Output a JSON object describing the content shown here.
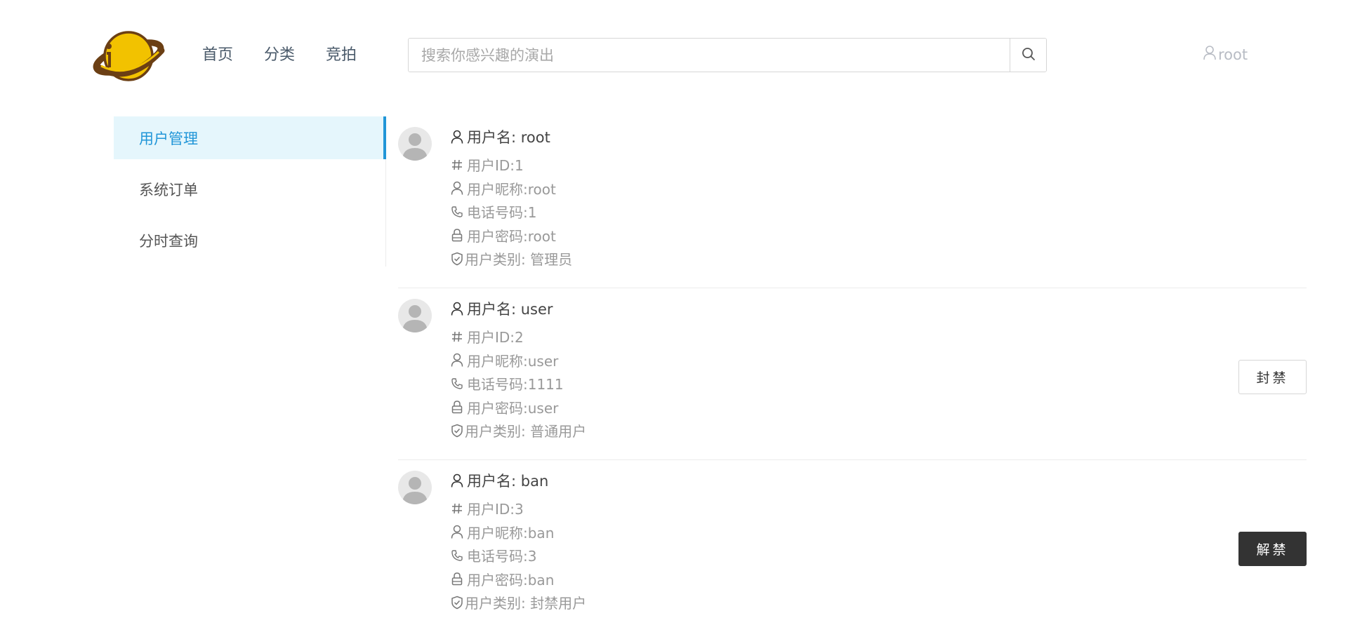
{
  "header": {
    "nav": [
      "首页",
      "分类",
      "竞拍"
    ],
    "search_placeholder": "搜索你感兴趣的演出",
    "current_user": "root"
  },
  "sidebar": {
    "items": [
      {
        "label": "用户管理",
        "active": true
      },
      {
        "label": "系统订单",
        "active": false
      },
      {
        "label": "分时查询",
        "active": false
      }
    ]
  },
  "users": [
    {
      "username": "用户名: root",
      "id": "用户ID:1",
      "nickname": "用户昵称:root",
      "phone": "电话号码:1",
      "password": "用户密码:root",
      "type": "用户类别: 管理员",
      "action": ""
    },
    {
      "username": "用户名: user",
      "id": "用户ID:2",
      "nickname": "用户昵称:user",
      "phone": "电话号码:1111",
      "password": "用户密码:user",
      "type": "用户类别: 普通用户",
      "action": "封禁"
    },
    {
      "username": "用户名: ban",
      "id": "用户ID:3",
      "nickname": "用户昵称:ban",
      "phone": "电话号码:3",
      "password": "用户密码:ban",
      "type": "用户类别: 封禁用户",
      "action": "解禁"
    }
  ],
  "icons": {
    "logo": "planet-logo",
    "search": "search-icon",
    "user": "user-icon",
    "id": "hash-icon",
    "phone": "phone-icon",
    "lock": "lock-icon",
    "shield": "shield-check-icon"
  },
  "colors": {
    "accent": "#2196d8",
    "active_bg": "#e5f6fc",
    "dark_button": "#333333"
  }
}
